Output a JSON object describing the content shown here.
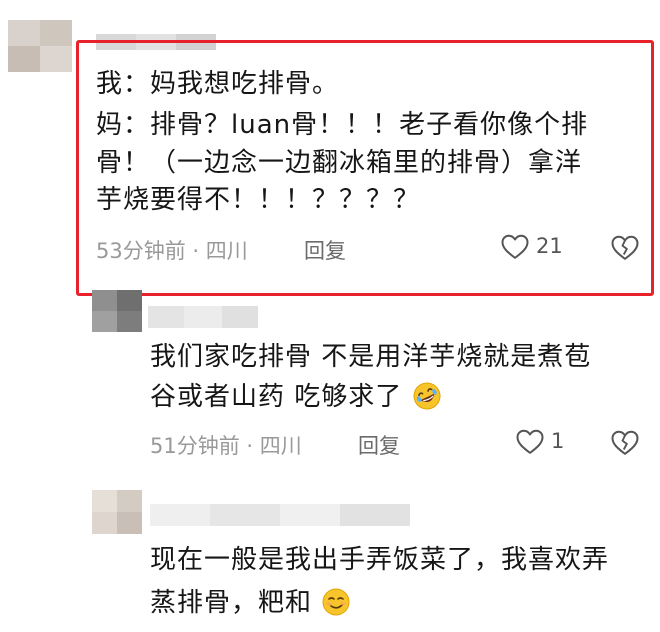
{
  "comments": [
    {
      "lines": [
        "我：妈我想吃排骨。",
        "妈：排骨？luan骨！！！老子看你像个排",
        "骨！（一边念一边翻冰箱里的排骨）拿洋",
        "芋烧要得不！！！？？？？"
      ],
      "meta": "53分钟前 · 四川",
      "reply": "回复",
      "likes": "21"
    },
    {
      "lines": [
        "我们家吃排骨 不是用洋芋烧就是煮苞",
        "谷或者山药 吃够求了"
      ],
      "meta": "51分钟前 · 四川",
      "reply": "回复",
      "likes": "1"
    },
    {
      "lines": [
        "现在一般是我出手弄饭菜了，我喜欢弄",
        "蒸排骨，粑和"
      ]
    }
  ],
  "colors": {
    "highlight": "#e8222a",
    "meta": "#999999"
  },
  "icons": [
    "heart-outline-icon",
    "broken-heart-icon",
    "rofl-emoji-icon",
    "smirk-emoji-icon"
  ]
}
